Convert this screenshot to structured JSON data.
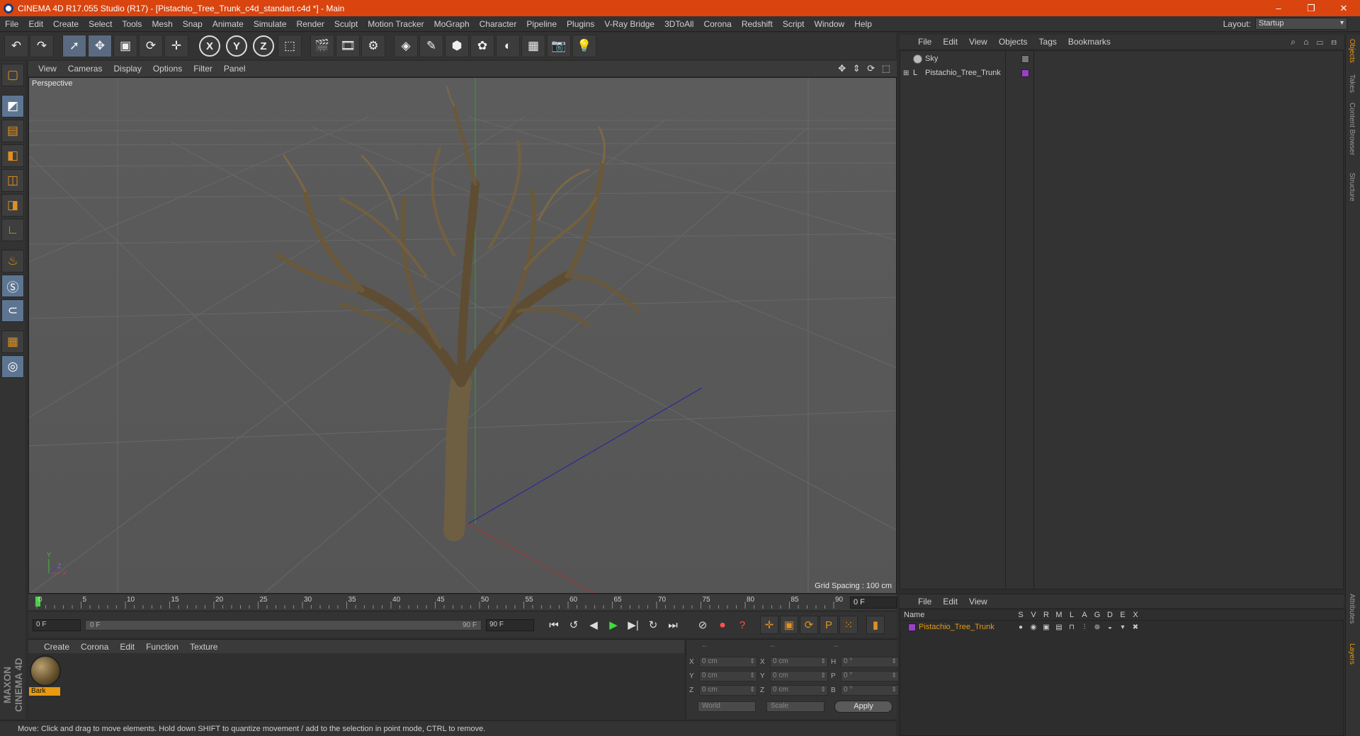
{
  "window": {
    "title": "CINEMA 4D R17.055 Studio (R17) - [Pistachio_Tree_Trunk_c4d_standart.c4d *] - Main",
    "minimize": "–",
    "restore": "❐",
    "close": "✕"
  },
  "menubar": {
    "items": [
      "File",
      "Edit",
      "Create",
      "Select",
      "Tools",
      "Mesh",
      "Snap",
      "Animate",
      "Simulate",
      "Render",
      "Sculpt",
      "Motion Tracker",
      "MoGraph",
      "Character",
      "Pipeline",
      "Plugins",
      "V-Ray Bridge",
      "3DToAll",
      "Corona",
      "Redshift",
      "Script",
      "Window",
      "Help"
    ],
    "layout_label": "Layout:",
    "layout_value": "Startup"
  },
  "toolbar": {
    "undo_icon": "↶",
    "redo_icon": "↷",
    "select_icon": "➚",
    "move_icon": "✥",
    "scale_icon": "▣",
    "rotate_icon": "⟳",
    "axis_move_icon": "✛",
    "x_label": "X",
    "y_label": "Y",
    "z_label": "Z",
    "coord_icon": "⬚",
    "render_icon": "🎬",
    "render_view_icon": "🎞",
    "render_settings_icon": "⚙",
    "cube_icon": "◈",
    "pen_icon": "✎",
    "subdiv_icon": "⬢",
    "array_icon": "✿",
    "deformer_icon": "◐",
    "floor_icon": "▦",
    "camera_icon": "📷",
    "light_icon": "💡"
  },
  "left_tools": [
    "▢",
    "◩",
    "▤",
    "◧",
    "◫",
    "◨",
    "∟",
    "♨",
    "Ⓢ",
    "⊂",
    "▦",
    "◎"
  ],
  "viewport": {
    "menu": [
      "View",
      "Cameras",
      "Display",
      "Options",
      "Filter",
      "Panel"
    ],
    "nav_icons": "✥ ⇕ ⟳ ⬚",
    "label": "Perspective",
    "grid_spacing": "Grid Spacing : 100 cm",
    "axis_y": "Y",
    "axis_x": "X",
    "axis_z": "Z"
  },
  "timeline": {
    "ticks": [
      "0",
      "5",
      "10",
      "15",
      "20",
      "25",
      "30",
      "35",
      "40",
      "45",
      "50",
      "55",
      "60",
      "65",
      "70",
      "75",
      "80",
      "85",
      "90"
    ],
    "current_frame": "0 F",
    "start_field": "0 F",
    "range_start": "0 F",
    "range_end": "90 F",
    "end_field": "90 F"
  },
  "transport": {
    "first": "⏮",
    "prev_key": "↺",
    "prev": "◀",
    "play": "▶",
    "next": "▶|",
    "next_key": "↻",
    "last": "⏭",
    "record_off": "⊘",
    "record": "⏺",
    "help": "?",
    "mode_move": "✛",
    "mode_scale": "▣",
    "mode_rotate": "⟳",
    "mode_param": "P",
    "mode_grid": "⁙",
    "film": "▮"
  },
  "materials": {
    "menu": [
      "Create",
      "Corona",
      "Edit",
      "Function",
      "Texture"
    ],
    "items": [
      {
        "name": "Bark"
      }
    ]
  },
  "coordinates": {
    "hdr1": "--",
    "hdr2": "--",
    "hdr3": "--",
    "rows": [
      {
        "a1": "X",
        "v1": "0 cm",
        "a2": "X",
        "v2": "0 cm",
        "a3": "H",
        "v3": "0 °"
      },
      {
        "a1": "Y",
        "v1": "0 cm",
        "a2": "Y",
        "v2": "0 cm",
        "a3": "P",
        "v3": "0 °"
      },
      {
        "a1": "Z",
        "v1": "0 cm",
        "a2": "Z",
        "v2": "0 cm",
        "a3": "B",
        "v3": "0 °"
      }
    ],
    "space": "World",
    "mode": "Scale",
    "apply": "Apply"
  },
  "status": {
    "text": "Move: Click and drag to move elements. Hold down SHIFT to quantize movement / add to the selection in point mode, CTRL to remove."
  },
  "brand": "MAXON CINEMA 4D",
  "object_manager": {
    "menu": [
      "File",
      "Edit",
      "View",
      "Objects",
      "Tags",
      "Bookmarks"
    ],
    "icons": "⌕ ⌂ ▭ ⊟",
    "objects": [
      {
        "name": "Sky",
        "expander": ""
      },
      {
        "name": "Pistachio_Tree_Trunk",
        "expander": "⊞"
      }
    ]
  },
  "layer_manager": {
    "menu": [
      "File",
      "Edit",
      "View"
    ],
    "columns": [
      "Name",
      "S",
      "V",
      "R",
      "M",
      "L",
      "A",
      "G",
      "D",
      "E",
      "X"
    ],
    "layers": [
      {
        "name": "Pistachio_Tree_Trunk"
      }
    ]
  },
  "right_tabs": [
    "Objects",
    "Takes",
    "Content Browser",
    "Structure",
    "Attributes",
    "Layers"
  ],
  "colors": {
    "titlebar": "#d9440f",
    "accent_orange": "#e89a10",
    "layer_purple": "#9a3fc9",
    "viewport_bg": "#5a5a5a"
  }
}
